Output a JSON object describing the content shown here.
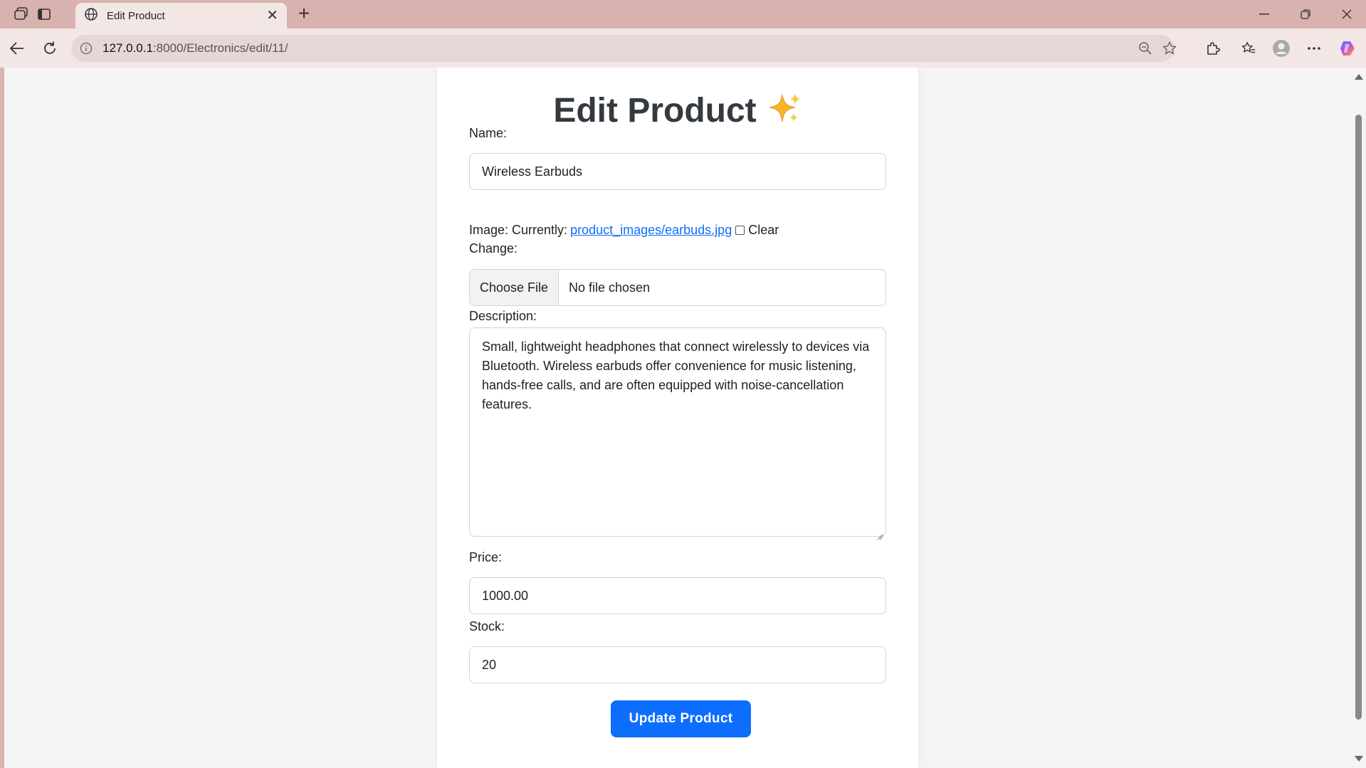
{
  "browser": {
    "tab_title": "Edit Product",
    "url_host": "127.0.0.1",
    "url_path": ":8000/Electronics/edit/11/"
  },
  "page": {
    "title": "Edit Product",
    "title_emoji": "sparkles-icon"
  },
  "form": {
    "name_label": "Name:",
    "name_value": "Wireless Earbuds",
    "image_label": "Image: Currently:",
    "image_link": "product_images/earbuds.jpg",
    "clear_label": "Clear",
    "change_label": "Change:",
    "file_button": "Choose File",
    "file_status": "No file chosen",
    "description_label": "Description:",
    "description_value": "Small, lightweight headphones that connect wirelessly to devices via Bluetooth. Wireless earbuds offer convenience for music listening, hands-free calls, and are often equipped with noise-cancellation features.",
    "price_label": "Price:",
    "price_value": "1000.00",
    "stock_label": "Stock:",
    "stock_value": "20",
    "submit_label": "Update Product"
  },
  "colors": {
    "accent": "#0d6efd",
    "title_text": "#343a40",
    "browser_frame": "#d8b2ae"
  }
}
